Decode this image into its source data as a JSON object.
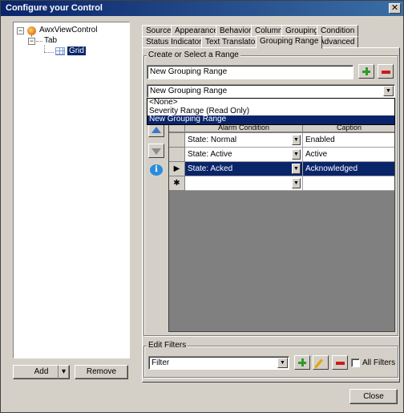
{
  "window": {
    "title": "Configure your Control",
    "close_glyph": "✕"
  },
  "tree": {
    "root": "AwxViewControl",
    "child": "Tab",
    "grandchild": "Grid",
    "expander_glyph": "−"
  },
  "left_buttons": {
    "add": "Add",
    "remove": "Remove",
    "dropdown_glyph": "▾"
  },
  "tabs_row1": [
    "Source",
    "Appearance",
    "Behavior",
    "Column",
    "Grouping",
    "Condition"
  ],
  "tabs_row2": [
    "Status Indicator",
    "Text Translator",
    "Grouping Range",
    "Advanced"
  ],
  "range_group": {
    "title": "Create or Select a Range",
    "name_value": "New Grouping Range",
    "select_value": "New Grouping Range",
    "options": [
      "<None>",
      "Severity Range (Read Only)",
      "New Grouping Range"
    ],
    "selected_index": 2
  },
  "grid": {
    "columns": [
      "Alarm Condition",
      "Caption"
    ],
    "rows": [
      {
        "condition": "State: Normal",
        "caption": "Enabled",
        "marker": ""
      },
      {
        "condition": "State: Active",
        "caption": "Active",
        "marker": ""
      },
      {
        "condition": "State: Acked",
        "caption": "Acknowledged",
        "marker": "▶"
      },
      {
        "condition": "",
        "caption": "",
        "marker": "✱"
      }
    ],
    "selected_row": 2
  },
  "filters": {
    "title": "Edit Filters",
    "filter_value": "Filter",
    "all_filters_label": "All Filters",
    "all_filters_checked": false
  },
  "close_button": "Close",
  "combo_glyph": "▼",
  "info_glyph": "i",
  "colors": {
    "selection": "#0a246a",
    "plus": "#2e9a2e",
    "minus": "#d01818",
    "arrow_up": "#3a79c8"
  }
}
